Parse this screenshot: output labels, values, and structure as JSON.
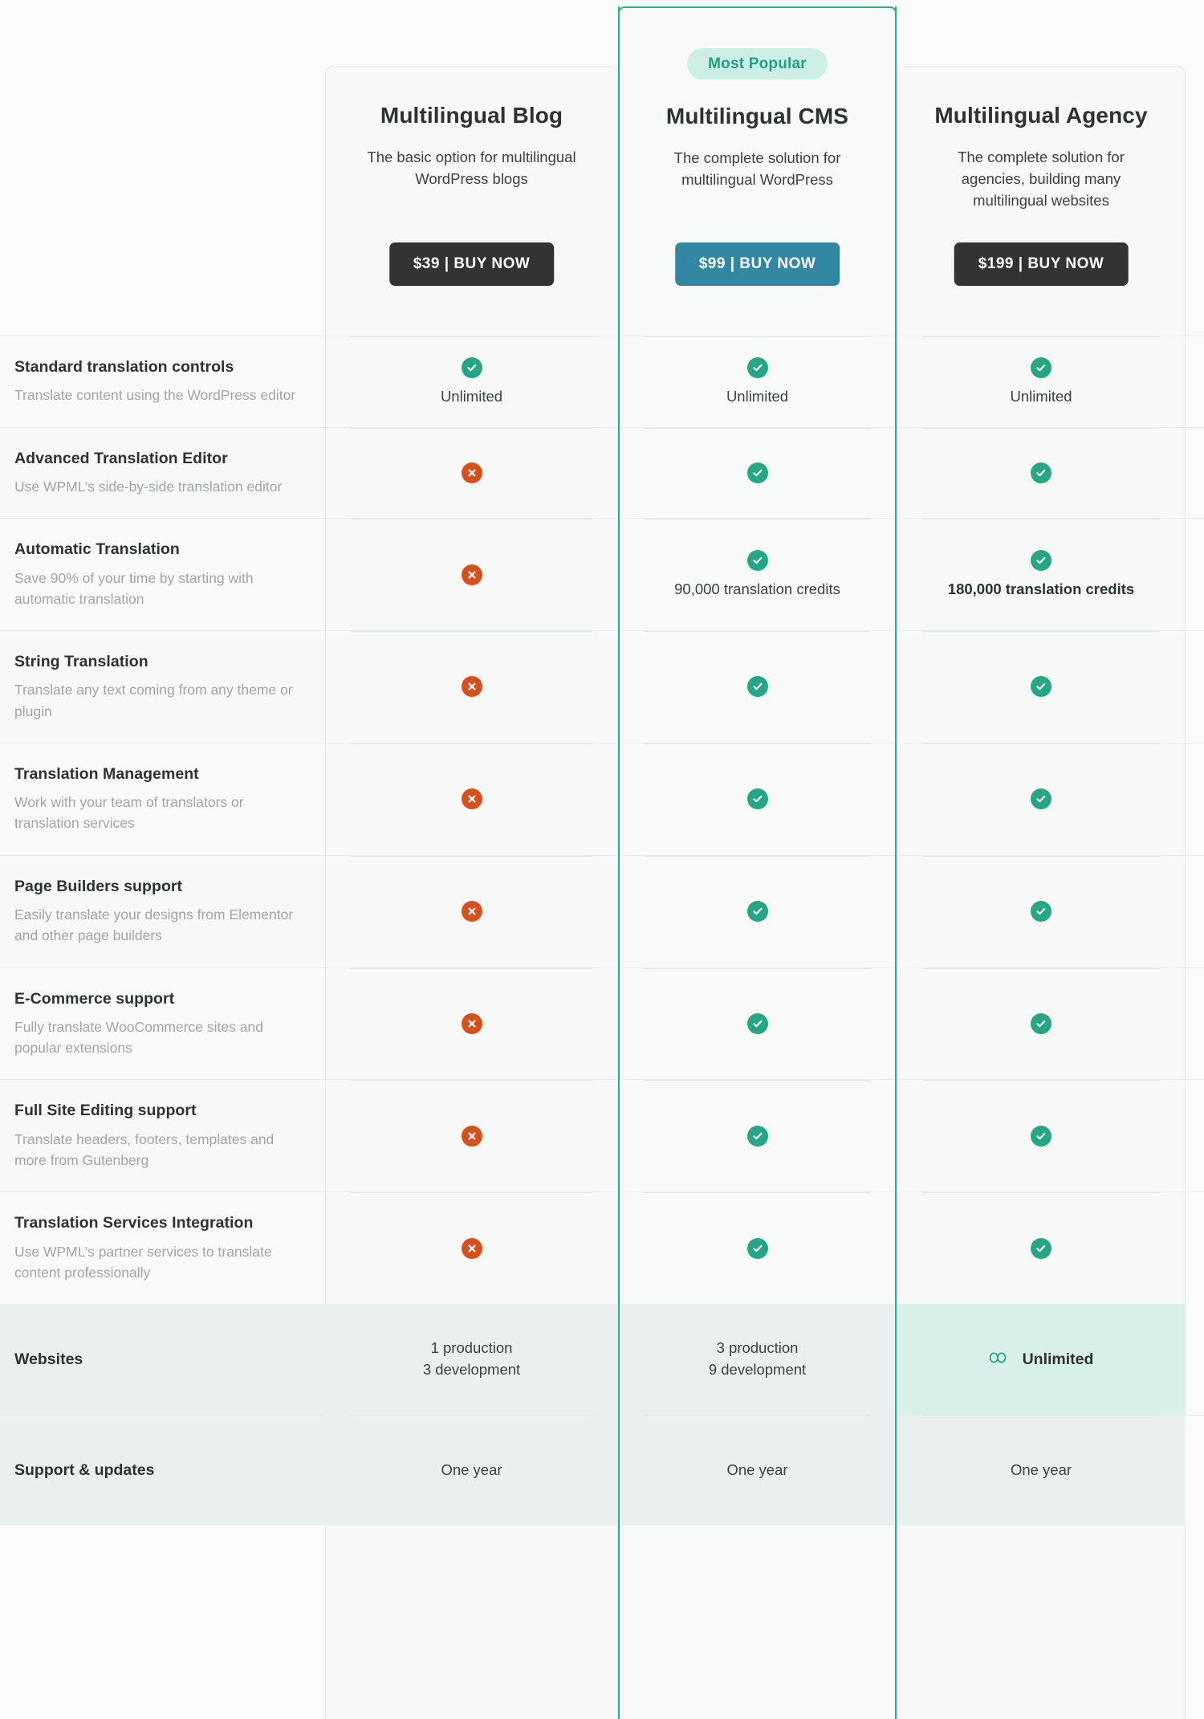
{
  "meta": {
    "badge_label": "Most Popular",
    "accent_color": "#2fab8e",
    "check_color": "#26a684",
    "cross_color": "#d4501d",
    "cta_dark_color": "#333333",
    "cta_accent_color": "#3287a2"
  },
  "plans": [
    {
      "name": "Multilingual Blog",
      "description": "The basic option for multilingual WordPress blogs",
      "cta": "$39 | BUY NOW",
      "popular": false
    },
    {
      "name": "Multilingual CMS",
      "description": "The complete solution for multilingual WordPress",
      "cta": "$99 | BUY NOW",
      "popular": true
    },
    {
      "name": "Multilingual Agency",
      "description": "The complete solution for agencies, building many multilingual websites",
      "cta": "$199 | BUY NOW",
      "popular": false
    }
  ],
  "features": [
    {
      "title": "Standard translation controls",
      "subtitle": "Translate content using the WordPress editor",
      "values": [
        {
          "icon": "check-icon",
          "text": "Unlimited",
          "bold": false
        },
        {
          "icon": "check-icon",
          "text": "Unlimited",
          "bold": false
        },
        {
          "icon": "check-icon",
          "text": "Unlimited",
          "bold": false
        }
      ]
    },
    {
      "title": "Advanced Translation Editor",
      "subtitle": "Use WPML’s side-by-side translation editor",
      "values": [
        {
          "icon": "cross-icon",
          "text": "",
          "bold": false
        },
        {
          "icon": "check-icon",
          "text": "",
          "bold": false
        },
        {
          "icon": "check-icon",
          "text": "",
          "bold": false
        }
      ]
    },
    {
      "title": "Automatic Translation",
      "subtitle": "Save 90% of your time by starting with automatic translation",
      "values": [
        {
          "icon": "cross-icon",
          "text": "",
          "bold": false
        },
        {
          "icon": "check-icon",
          "text": "90,000 translation credits",
          "bold": false
        },
        {
          "icon": "check-icon",
          "text": "180,000 translation credits",
          "bold": true
        }
      ]
    },
    {
      "title": "String Translation",
      "subtitle": "Translate any text coming from any theme or plugin",
      "values": [
        {
          "icon": "cross-icon",
          "text": "",
          "bold": false
        },
        {
          "icon": "check-icon",
          "text": "",
          "bold": false
        },
        {
          "icon": "check-icon",
          "text": "",
          "bold": false
        }
      ]
    },
    {
      "title": "Translation Management",
      "subtitle": "Work with your team of translators or translation services",
      "values": [
        {
          "icon": "cross-icon",
          "text": "",
          "bold": false
        },
        {
          "icon": "check-icon",
          "text": "",
          "bold": false
        },
        {
          "icon": "check-icon",
          "text": "",
          "bold": false
        }
      ]
    },
    {
      "title": "Page Builders support",
      "subtitle": "Easily translate your designs from Elementor and other page builders",
      "values": [
        {
          "icon": "cross-icon",
          "text": "",
          "bold": false
        },
        {
          "icon": "check-icon",
          "text": "",
          "bold": false
        },
        {
          "icon": "check-icon",
          "text": "",
          "bold": false
        }
      ]
    },
    {
      "title": "E-Commerce support",
      "subtitle": "Fully translate WooCommerce sites and popular extensions",
      "values": [
        {
          "icon": "cross-icon",
          "text": "",
          "bold": false
        },
        {
          "icon": "check-icon",
          "text": "",
          "bold": false
        },
        {
          "icon": "check-icon",
          "text": "",
          "bold": false
        }
      ]
    },
    {
      "title": "Full Site Editing support",
      "subtitle": "Translate headers, footers, templates and more from Gutenberg",
      "values": [
        {
          "icon": "cross-icon",
          "text": "",
          "bold": false
        },
        {
          "icon": "check-icon",
          "text": "",
          "bold": false
        },
        {
          "icon": "check-icon",
          "text": "",
          "bold": false
        }
      ]
    },
    {
      "title": "Translation Services Integration",
      "subtitle": "Use WPML’s partner services to translate content professionally",
      "values": [
        {
          "icon": "cross-icon",
          "text": "",
          "bold": false
        },
        {
          "icon": "check-icon",
          "text": "",
          "bold": false
        },
        {
          "icon": "check-icon",
          "text": "",
          "bold": false
        }
      ]
    }
  ],
  "summary": [
    {
      "label": "Websites",
      "values": [
        {
          "lines": [
            "1 production",
            "3 development"
          ],
          "icon": null,
          "bold": false
        },
        {
          "lines": [
            "3 production",
            "9 development"
          ],
          "icon": null,
          "bold": false
        },
        {
          "lines": [
            "Unlimited"
          ],
          "icon": "infinity-icon",
          "bold": true
        }
      ]
    },
    {
      "label": "Support & updates",
      "values": [
        {
          "lines": [
            "One year"
          ],
          "icon": null,
          "bold": false
        },
        {
          "lines": [
            "One year"
          ],
          "icon": null,
          "bold": false
        },
        {
          "lines": [
            "One year"
          ],
          "icon": null,
          "bold": false
        }
      ]
    }
  ]
}
